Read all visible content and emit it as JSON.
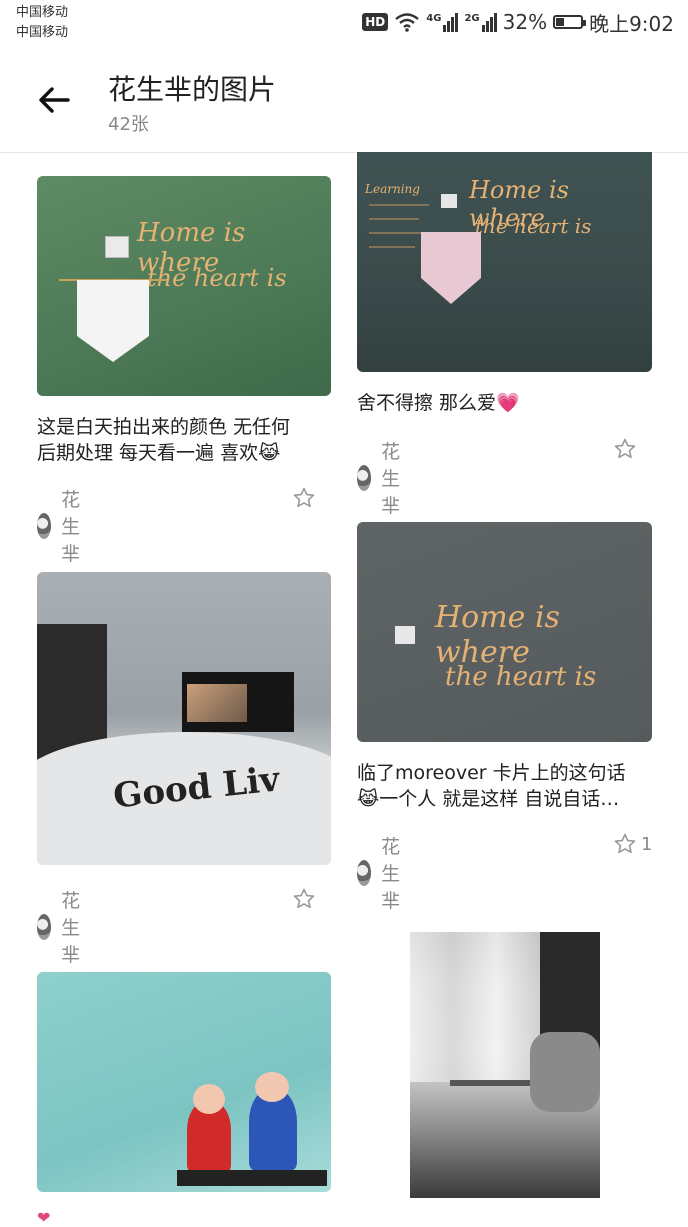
{
  "status": {
    "carrier1": "中国移动",
    "carrier2": "中国移动",
    "hd": "HD",
    "net1": "4G",
    "net2": "2G",
    "battery": "32%",
    "battery_level": 0.32,
    "time": "晚上9:02"
  },
  "header": {
    "title": "花生芈的图片",
    "count": "42张"
  },
  "posts": [
    {
      "caption_line1": "这是白天拍出来的颜色  无任何",
      "caption_line2": "后期处理 每天看一遍 喜欢😹",
      "author": "花生芈",
      "likes": ""
    },
    {
      "caption_line1": "舍不得擦 那么爱💗",
      "author": "花生芈",
      "likes": ""
    },
    {
      "caption_line1": "临了moreover 卡片上的这句话",
      "caption_line2": "😹一个人  就是这样  自说自话…",
      "author": "花生芈",
      "likes": "1"
    },
    {
      "author": "花生芈",
      "likes": ""
    }
  ],
  "colors": {
    "accent": "#e6b273",
    "muted": "#8a8a8a"
  },
  "icons": [
    "back-arrow-icon",
    "star-icon",
    "wifi-icon",
    "battery-icon"
  ]
}
